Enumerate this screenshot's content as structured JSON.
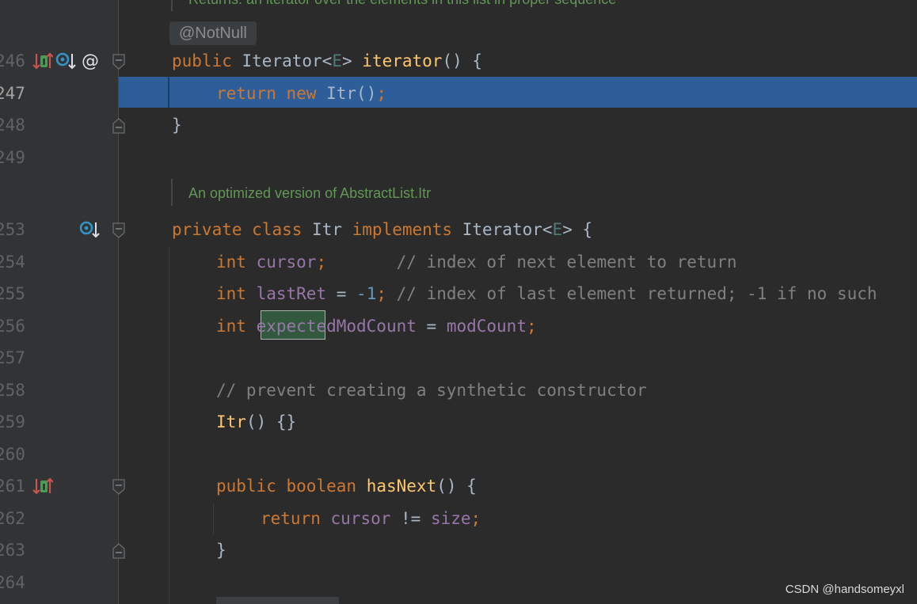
{
  "gutter": {
    "line_numbers": [
      "246",
      "247",
      "248",
      "249",
      "253",
      "254",
      "255",
      "256",
      "257",
      "258",
      "259",
      "260",
      "261",
      "262",
      "263",
      "264"
    ],
    "current_line": "247"
  },
  "inlays": {
    "doc_top": "Returns: an iterator over the elements in this list in proper sequence",
    "annotation": "@NotNull",
    "doc_mid": "An optimized version of AbstractList.Itr"
  },
  "code": {
    "l246": {
      "kw": "public",
      "type": "Iterator",
      "lt": "<",
      "gen": "E",
      "gt": ">",
      "name": "iterator",
      "rest": "() {"
    },
    "l247": {
      "kw1": "return",
      "kw2": "new",
      "type": "Itr",
      "paren": "()",
      "semi": ";"
    },
    "l248": {
      "text": "}"
    },
    "l253": {
      "kw1": "private",
      "kw2": "class",
      "name": "Itr",
      "kw3": "implements",
      "type": "Iterator",
      "lt": "<",
      "gen": "E",
      "gt": ">",
      "rest": " {"
    },
    "l254": {
      "kw": "int",
      "field": "cursor",
      "semi": ";",
      "comment": "// index of next element to return"
    },
    "l255": {
      "kw": "int",
      "field": "lastRet",
      "eq": " = ",
      "num": "-1",
      "semi": ";",
      "comment": "// index of last element returned; -1 if no such"
    },
    "l256": {
      "kw": "int",
      "field_a": "expect",
      "field_b": "edModCount",
      "eq": " = ",
      "value": "modCount",
      "semi": ";"
    },
    "l258": {
      "comment": "// prevent creating a synthetic constructor"
    },
    "l259": {
      "name": "Itr",
      "rest": "() {}"
    },
    "l261": {
      "kw1": "public",
      "kw2": "boolean",
      "name": "hasNext",
      "rest": "() {"
    },
    "l262": {
      "kw": "return",
      "field1": "cursor",
      "op": " != ",
      "field2": "size",
      "semi": ";"
    },
    "l263": {
      "text": "}"
    }
  },
  "icons": {
    "l246": [
      "implements-method-icon",
      "overridden-method-icon",
      "annotation-icon"
    ],
    "l253": [
      "overridden-class-icon"
    ],
    "l261": [
      "implements-method-icon"
    ]
  },
  "colors": {
    "background": "#2b2b2b",
    "gutter": "#313335",
    "keyword": "#cc7832",
    "function": "#ffc66d",
    "field": "#9876aa",
    "comment": "#808080",
    "doc": "#629755",
    "highlight": "#2d5e9a"
  },
  "watermark": "CSDN @handsomeyxl"
}
